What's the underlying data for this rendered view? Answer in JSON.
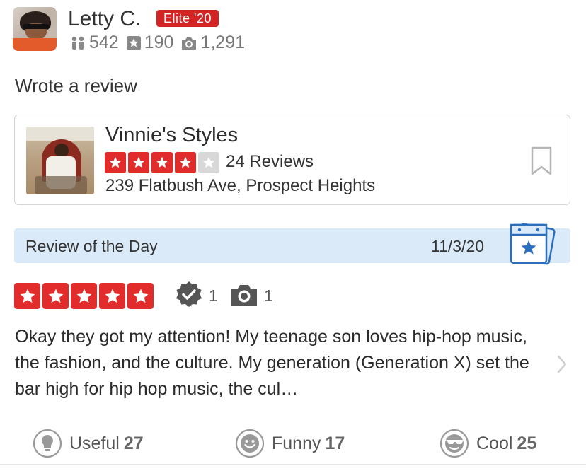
{
  "user": {
    "name": "Letty C.",
    "badge": "Elite '20",
    "friends": "542",
    "reviews": "190",
    "photos": "1,291"
  },
  "activity": "Wrote a review",
  "business": {
    "name": "Vinnie's Styles",
    "rating": 4,
    "max_rating": 5,
    "review_count": "24 Reviews",
    "address": "239 Flatbush Ave, Prospect Heights",
    "icons": [
      "business-photo",
      "bookmark-icon"
    ]
  },
  "review_of_the_day": {
    "label": "Review of the Day",
    "date": "11/3/20"
  },
  "review": {
    "rating": 5,
    "check_ins": "1",
    "photos": "1",
    "text": "Okay they got my attention! My teenage son loves hip-hop music, the fashion, and the culture. My generation (Generation X) set the bar high for hip hop music, the cul…"
  },
  "reactions": [
    {
      "label": "Useful",
      "count": "27",
      "icon": "lightbulb-icon"
    },
    {
      "label": "Funny",
      "count": "17",
      "icon": "smile-icon"
    },
    {
      "label": "Cool",
      "count": "25",
      "icon": "sunglasses-icon"
    }
  ],
  "colors": {
    "accent_red": "#d32323",
    "star_red": "#e12c2b",
    "star_empty": "#d8d8d8",
    "banner_blue": "#dbeaf8",
    "badge_blue": "#2d6fbf"
  }
}
